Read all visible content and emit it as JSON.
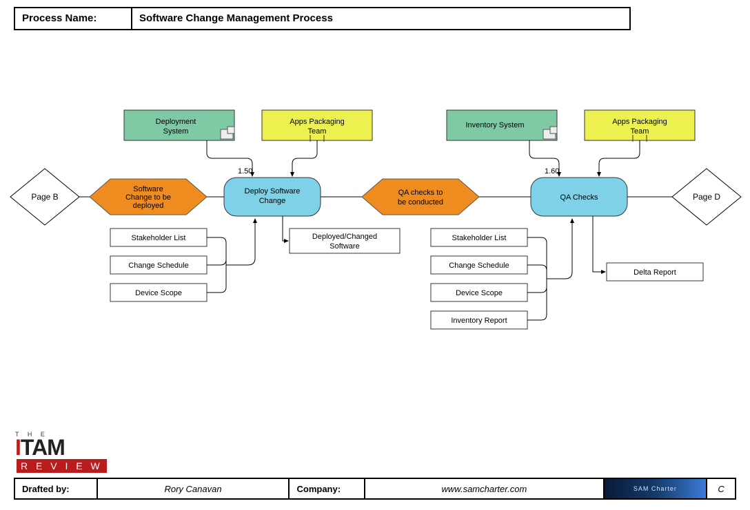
{
  "header": {
    "label": "Process Name:",
    "title": "Software Change Management Process"
  },
  "nodes": {
    "pageB": "Page B",
    "pageD": "Page D",
    "deploymentSystem": "Deployment System",
    "appsPackagingTeam1": "Apps Packaging Team",
    "inventorySystem": "Inventory System",
    "appsPackagingTeam2": "Apps Packaging Team",
    "hexLeft": "Software Change to be deployed",
    "stepLeft": {
      "num": "1.50",
      "label": "Deploy Software Change"
    },
    "hexRight": "QA checks to be conducted",
    "stepRight": {
      "num": "1.60",
      "label": "QA Checks"
    },
    "outLeft": "Deployed/Changed Software",
    "outRight": "Delta Report",
    "inputsLeft": [
      "Stakeholder List",
      "Change Schedule",
      "Device Scope"
    ],
    "inputsRight": [
      "Stakeholder List",
      "Change Schedule",
      "Device Scope",
      "Inventory Report"
    ]
  },
  "footer": {
    "draftedLabel": "Drafted by:",
    "drafted": "Rory Canavan",
    "companyLabel": "Company:",
    "company": "www.samcharter.com",
    "logoText": "SAM Charter",
    "page": "C"
  },
  "logo": {
    "the": "T H E",
    "itam_i": "I",
    "itam_tam": "TAM",
    "review": "R E V I E W"
  }
}
